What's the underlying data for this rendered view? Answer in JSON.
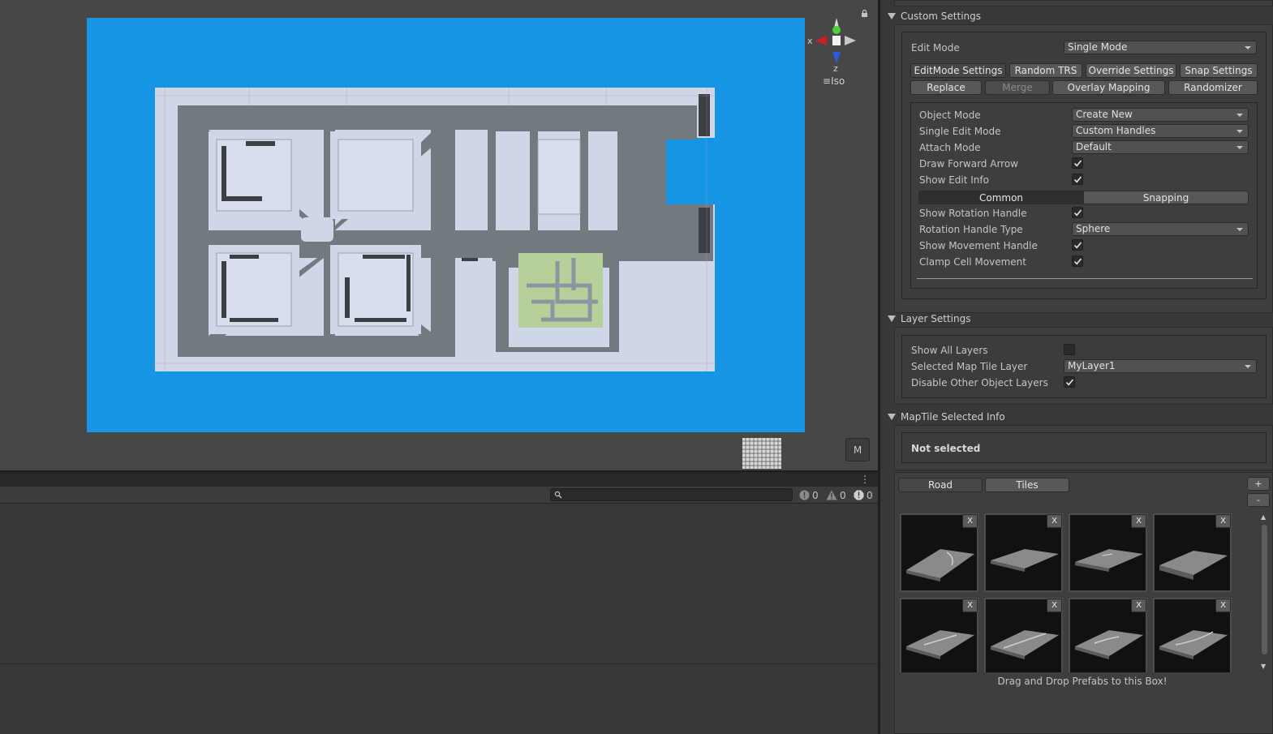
{
  "scene": {
    "gizmo_axes": {
      "x": "x",
      "z": "z"
    },
    "projection_label": "Iso",
    "m_button": "M",
    "colors": {
      "sky": "#1595e4",
      "floor": "#cfd6e8",
      "road": "#727a80",
      "grass": "#b7cf98"
    }
  },
  "console": {
    "search_placeholder": "",
    "counters": [
      {
        "icon": "info-icon",
        "value": "0"
      },
      {
        "icon": "warning-icon",
        "value": "0"
      },
      {
        "icon": "error-icon",
        "value": "0"
      }
    ]
  },
  "inspector": {
    "custom_settings": {
      "title": "Custom Settings",
      "edit_mode_label": "Edit Mode",
      "edit_mode_value": "Single Mode",
      "tabs_row1": [
        "EditMode Settings",
        "Random TRS",
        "Override Settings",
        "Snap Settings"
      ],
      "tabs_row2": [
        "Replace",
        "Merge",
        "Overlay Mapping",
        "Randomizer"
      ],
      "object_mode_label": "Object Mode",
      "object_mode_value": "Create New",
      "single_edit_mode_label": "Single Edit Mode",
      "single_edit_mode_value": "Custom Handles",
      "attach_mode_label": "Attach Mode",
      "attach_mode_value": "Default",
      "draw_forward_arrow_label": "Draw Forward Arrow",
      "show_edit_info_label": "Show Edit Info",
      "segment_common": "Common",
      "segment_snapping": "Snapping",
      "show_rotation_handle_label": "Show Rotation Handle",
      "rotation_handle_type_label": "Rotation Handle Type",
      "rotation_handle_type_value": "Sphere",
      "show_movement_handle_label": "Show Movement Handle",
      "clamp_cell_movement_label": "Clamp Cell Movement"
    },
    "layer_settings": {
      "title": "Layer Settings",
      "show_all_layers_label": "Show All Layers",
      "selected_layer_label": "Selected Map Tile Layer",
      "selected_layer_value": "MyLayer1",
      "disable_other_layers_label": "Disable Other Object Layers"
    },
    "maptile_info": {
      "title": "MapTile Selected Info",
      "status": "Not selected"
    },
    "palette": {
      "tabs": [
        "Road",
        "Tiles"
      ],
      "add_label": "+",
      "remove_label": "-",
      "tile_close_label": "X",
      "drop_hint": "Drag and Drop Prefabs to this Box!"
    }
  }
}
